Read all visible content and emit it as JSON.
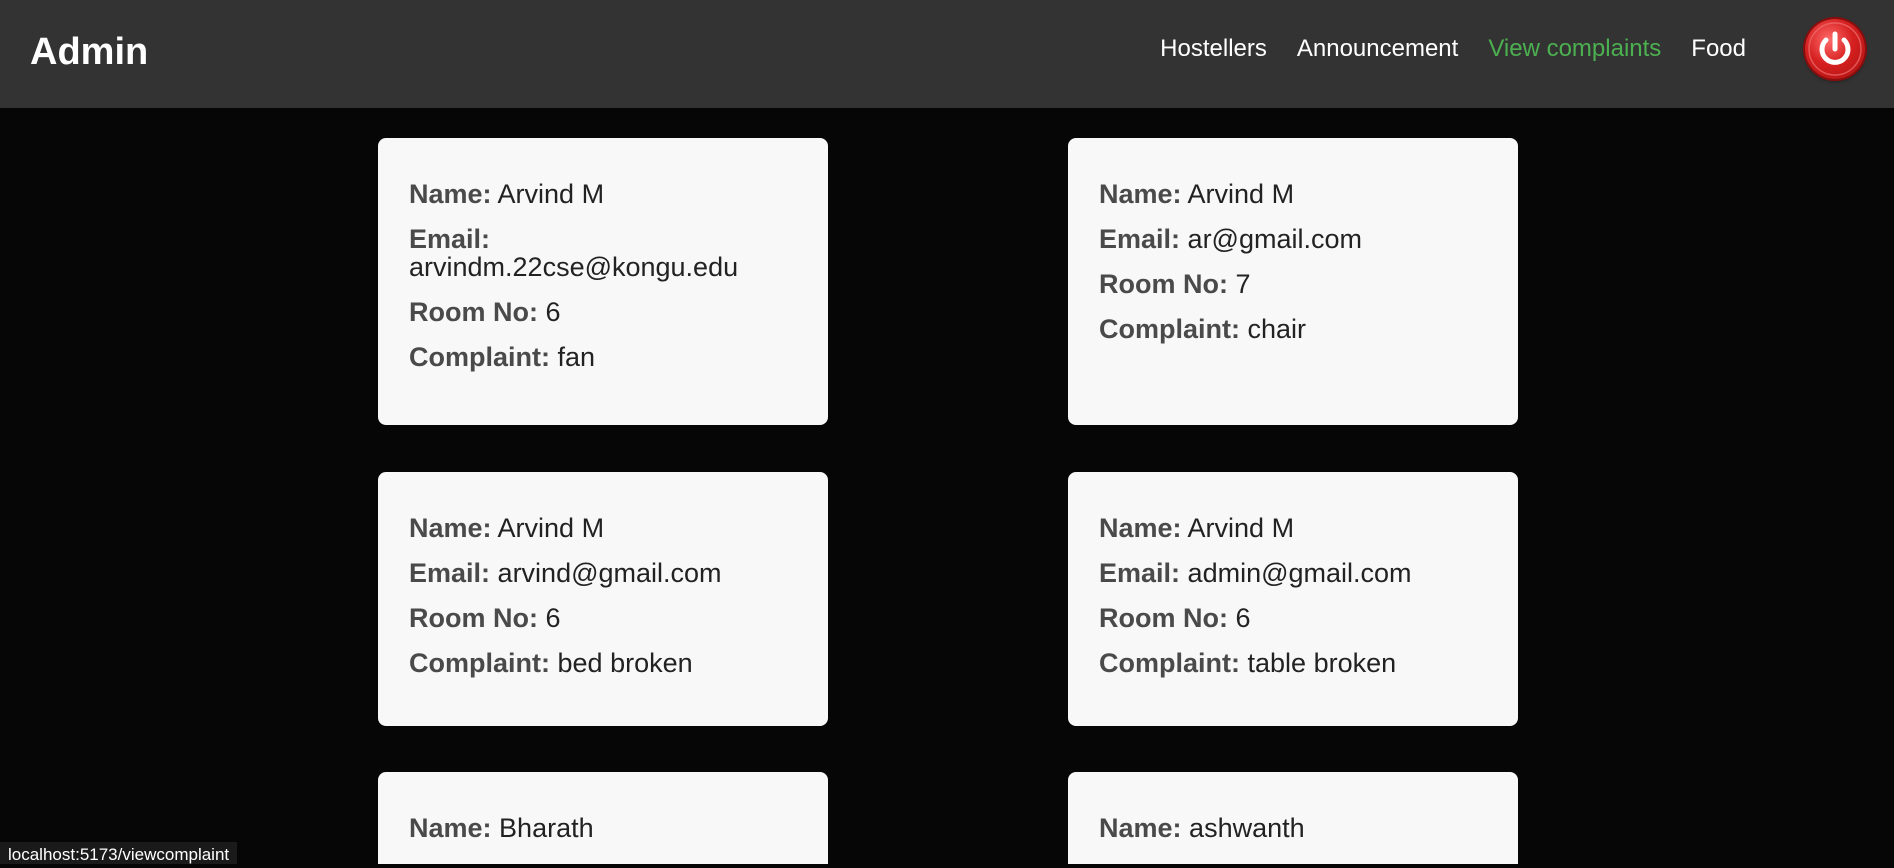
{
  "header": {
    "brand": "Admin",
    "nav": [
      {
        "label": "Hostellers",
        "active": false
      },
      {
        "label": "Announcement",
        "active": false
      },
      {
        "label": "View complaints",
        "active": true
      },
      {
        "label": "Food",
        "active": false
      }
    ],
    "logout_icon": "power-icon",
    "accent_color": "#4cb050"
  },
  "labels": {
    "name": "Name:",
    "email": "Email:",
    "room": "Room No:",
    "complaint": "Complaint:"
  },
  "complaints": [
    {
      "name": "Arvind M",
      "email": "arvindm.22cse@kongu.edu",
      "room": "6",
      "complaint": "fan"
    },
    {
      "name": "Arvind M",
      "email": "ar@gmail.com",
      "room": "7",
      "complaint": "chair"
    },
    {
      "name": "Arvind M",
      "email": "arvind@gmail.com",
      "room": "6",
      "complaint": "bed broken"
    },
    {
      "name": "Arvind M",
      "email": "admin@gmail.com",
      "room": "6",
      "complaint": "table broken"
    },
    {
      "name": "Bharath"
    },
    {
      "name": "ashwanth"
    }
  ],
  "status_bar": "localhost:5173/viewcomplaint"
}
